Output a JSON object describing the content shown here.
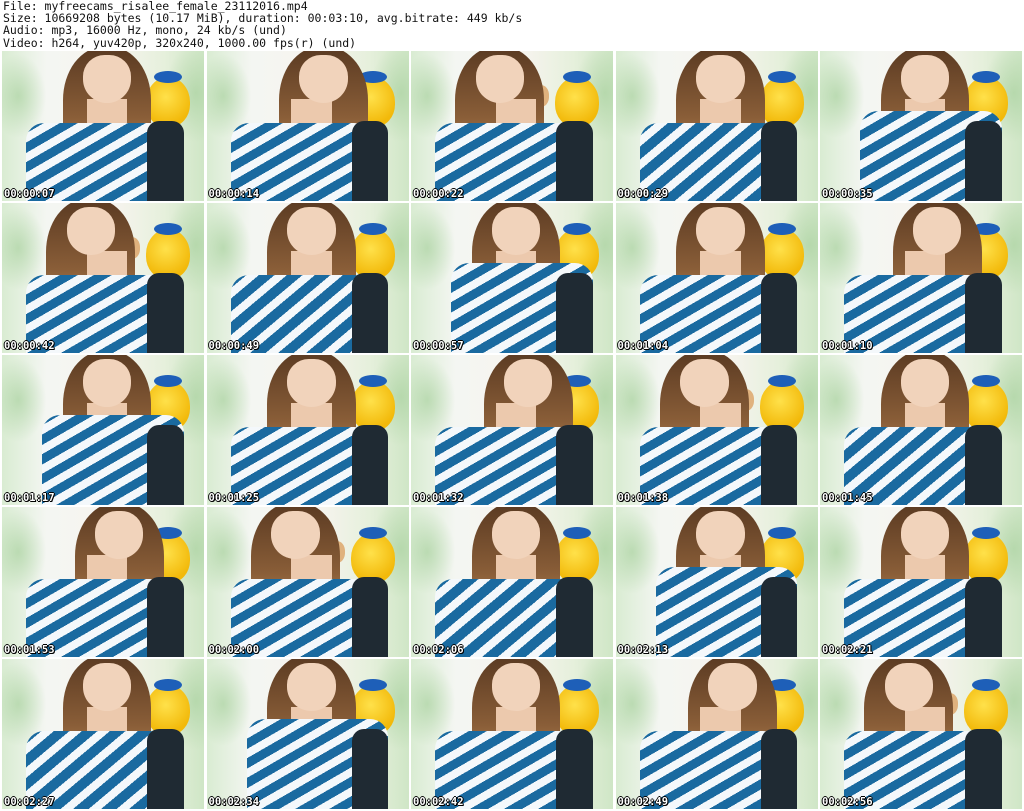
{
  "info": {
    "file": "File: myfreecams_risalee_female_23112016.mp4",
    "size": "Size: 10669208 bytes (10.17 MiB), duration: 00:03:10, avg.bitrate: 449 kb/s",
    "audio": "Audio: mp3, 16000 Hz, mono, 24 kb/s (und)",
    "video": "Video: h264, yuv420p, 320x240, 1000.00 fps(r) (und)"
  },
  "thumbnails": [
    {
      "time": "00:00:07"
    },
    {
      "time": "00:00:14"
    },
    {
      "time": "00:00:22"
    },
    {
      "time": "00:00:29"
    },
    {
      "time": "00:00:35"
    },
    {
      "time": "00:00:42"
    },
    {
      "time": "00:00:49"
    },
    {
      "time": "00:00:57"
    },
    {
      "time": "00:01:04"
    },
    {
      "time": "00:01:10"
    },
    {
      "time": "00:01:17"
    },
    {
      "time": "00:01:25"
    },
    {
      "time": "00:01:32"
    },
    {
      "time": "00:01:38"
    },
    {
      "time": "00:01:45"
    },
    {
      "time": "00:01:53"
    },
    {
      "time": "00:02:00"
    },
    {
      "time": "00:02:06"
    },
    {
      "time": "00:02:13"
    },
    {
      "time": "00:02:21"
    },
    {
      "time": "00:02:27"
    },
    {
      "time": "00:02:34"
    },
    {
      "time": "00:02:42"
    },
    {
      "time": "00:02:49"
    },
    {
      "time": "00:02:56"
    }
  ],
  "colors": {
    "background": "#ffffff",
    "timestamp_text": "#ffffff",
    "stripe_blue": "#1a6aa0",
    "plush_yellow": "#f2b90a"
  }
}
